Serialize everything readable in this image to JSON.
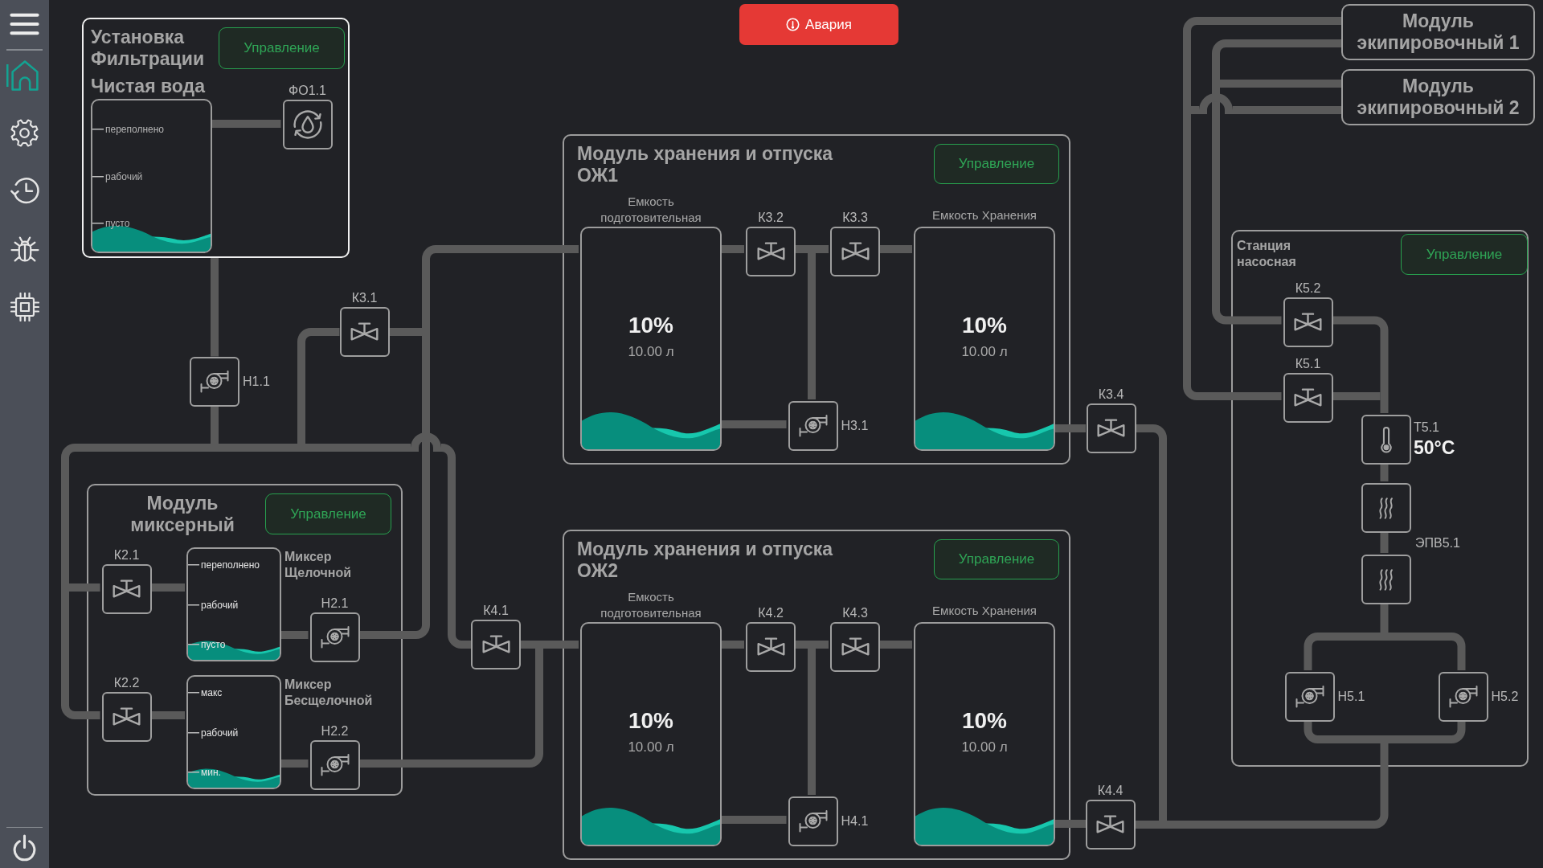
{
  "sidebar": {
    "nav_items": [
      {
        "selected": true
      },
      {
        "selected": false
      },
      {
        "selected": false
      },
      {
        "selected": false
      },
      {
        "selected": false
      }
    ]
  },
  "alarm_button": {
    "label": "Авария"
  },
  "filtration_unit": {
    "title": "Установка Фильтрации",
    "selected": true,
    "control_button": "Управление",
    "tank": {
      "title": "Чистая вода",
      "marks": [
        "переполнено",
        "рабочий",
        "пусто"
      ],
      "level": 0.1
    },
    "filter": {
      "kind": "filter",
      "label": "ФО1.1"
    }
  },
  "line_devices": [
    {
      "kind": "pump",
      "label": "Н1.1"
    },
    {
      "kind": "valve",
      "label": "К3.1"
    },
    {
      "kind": "valve",
      "label": "К4.1"
    },
    {
      "kind": "valve",
      "label": "К3.4"
    },
    {
      "kind": "valve",
      "label": "К4.4"
    }
  ],
  "mixer_module": {
    "title": "Модуль миксерный",
    "selected": false,
    "control_button": "Управление",
    "mixers": [
      {
        "name": "Миксер Щелочной",
        "valve": {
          "kind": "valve",
          "label": "К2.1"
        },
        "tank": {
          "marks": [
            "переполнено",
            "рабочий",
            "пусто"
          ],
          "level": 0.1
        },
        "pump": {
          "kind": "pump",
          "label": "Н2.1"
        }
      },
      {
        "name": "Миксер Бесщелочной",
        "valve": {
          "kind": "valve",
          "label": "К2.2"
        },
        "tank": {
          "marks": [
            "макс",
            "рабочий",
            "мин."
          ],
          "level": 0.1
        },
        "pump": {
          "kind": "pump",
          "label": "Н2.2"
        }
      }
    ]
  },
  "storage_modules": [
    {
      "title": "Модуль хранения и отпуска ОЖ1",
      "selected": false,
      "control_button": "Управление",
      "prep_tank": {
        "title": "Емкость подготовительная",
        "percent": "10%",
        "volume": "10.00 л",
        "level": 0.1
      },
      "valves": [
        {
          "kind": "valve",
          "label": "К3.2"
        },
        {
          "kind": "valve",
          "label": "К3.3"
        }
      ],
      "pump": {
        "kind": "pump",
        "label": "Н3.1"
      },
      "storage_tank": {
        "title": "Емкость Хранения",
        "percent": "10%",
        "volume": "10.00 л",
        "level": 0.1
      }
    },
    {
      "title": "Модуль хранения и отпуска ОЖ2",
      "selected": false,
      "control_button": "Управление",
      "prep_tank": {
        "title": "Емкость подготовительная",
        "percent": "10%",
        "volume": "10.00 л",
        "level": 0.1
      },
      "valves": [
        {
          "kind": "valve",
          "label": "К4.2"
        },
        {
          "kind": "valve",
          "label": "К4.3"
        }
      ],
      "pump": {
        "kind": "pump",
        "label": "Н4.1"
      },
      "storage_tank": {
        "title": "Емкость Хранения",
        "percent": "10%",
        "volume": "10.00 л",
        "level": 0.1
      }
    }
  ],
  "equipment_modules": [
    {
      "title": "Модуль экипировочный 1",
      "selected": false
    },
    {
      "title": "Модуль экипировочный 2",
      "selected": false
    }
  ],
  "pump_station": {
    "title": "Станция насосная",
    "selected": false,
    "control_button": "Управление",
    "valves": [
      {
        "kind": "valve",
        "label": "К5.2"
      },
      {
        "kind": "valve",
        "label": "К5.1"
      }
    ],
    "thermometer": {
      "kind": "thermometer",
      "label": "Т5.1",
      "reading": "50°C"
    },
    "heater": {
      "kind": "heater",
      "label": "ЭПВ5.1"
    },
    "pumps": [
      {
        "kind": "pump",
        "label": "Н5.1"
      },
      {
        "kind": "pump",
        "label": "Н5.2"
      }
    ]
  }
}
